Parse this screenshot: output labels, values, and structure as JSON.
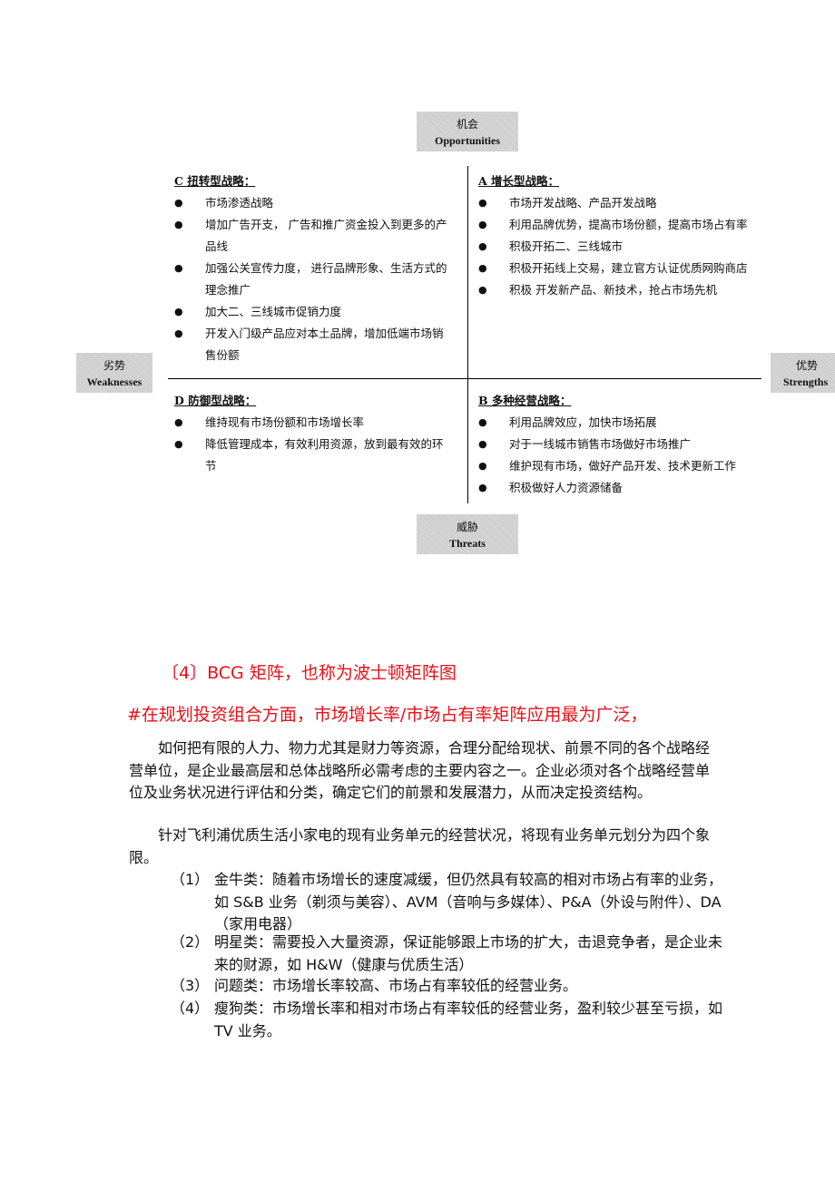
{
  "swot": {
    "top": {
      "zh": "机会",
      "en": "Opportunities"
    },
    "bottom": {
      "zh": "威胁",
      "en": "Threats"
    },
    "left": {
      "zh": "劣势",
      "en": "Weaknesses"
    },
    "right": {
      "zh": "优势",
      "en": "Strengths"
    },
    "quadrants": {
      "C": {
        "title": "C 扭转型战略：",
        "items": [
          "市场渗透战略",
          "增加广告开支， 广告和推广资金投入到更多的产品线",
          "加强公关宣传力度， 进行品牌形象、生活方式的理念推广",
          "加大二、三线城市促销力度",
          "开发入门级产品应对本土品牌，增加低端市场销售份额"
        ]
      },
      "A": {
        "title": "A 增长型战略：",
        "items": [
          "市场开发战略、产品开发战略",
          "利用品牌优势，提高市场份额，提高市场占有率",
          "积极开拓二、三线城市",
          "积极开拓线上交易，建立官方认证优质网购商店",
          "积极 开发新产品、新技术，抢占市场先机"
        ]
      },
      "D": {
        "title": "D 防御型战略：",
        "items": [
          "维持现有市场份额和市场增长率",
          "降低管理成本，有效利用资源，放到最有效的环节"
        ]
      },
      "B": {
        "title": "B 多种经营战略：",
        "items": [
          "利用品牌效应，加快市场拓展",
          "对于一线城市销售市场做好市场推广",
          "维护现有市场，做好产品开发、技术更新工作",
          "积极做好人力资源储备"
        ]
      }
    }
  },
  "section_heading": "〔4〕BCG 矩阵，也称为波士顿矩阵图",
  "hash_line": "#在规划投资组合方面，市场增长率/市场占有率矩阵应用最为广泛，",
  "paragraphs": [
    "如何把有限的人力、物力尤其是财力等资源，合理分配给现状、前景不同的各个战略经营单位，是企业最高层和总体战略所必需考虑的主要内容之一。企业必须对各个战略经营单位及业务状况进行评估和分类，确定它们的前景和发展潜力，从而决定投资结构。",
    "针对飞利浦优质生活小家电的现有业务单元的经营状况，将现有业务单元划分为四个象限。"
  ],
  "list": [
    {
      "num": "（1）",
      "text": "金牛类：随着市场增长的速度减缓，但仍然具有较高的相对市场占有率的业务，如 S&B 业务（剃须与美容）、AVM（音响与多媒体）、P&A（外设与附件）、DA（家用电器）"
    },
    {
      "num": "（2）",
      "text": "明星类：需要投入大量资源，保证能够跟上市场的扩大，击退竞争者，是企业未来的财源，如 H&W（健康与优质生活）"
    },
    {
      "num": "（3）",
      "text": "问题类：市场增长率较高、市场占有率较低的经营业务。"
    },
    {
      "num": "（4）",
      "text": "瘦狗类：市场增长率和相对市场占有率较低的经营业务，盈利较少甚至亏损，如 TV 业务。"
    }
  ],
  "colors": {
    "heading_red": "#e8101a",
    "axis_box_gray": "#c8c8c8"
  }
}
